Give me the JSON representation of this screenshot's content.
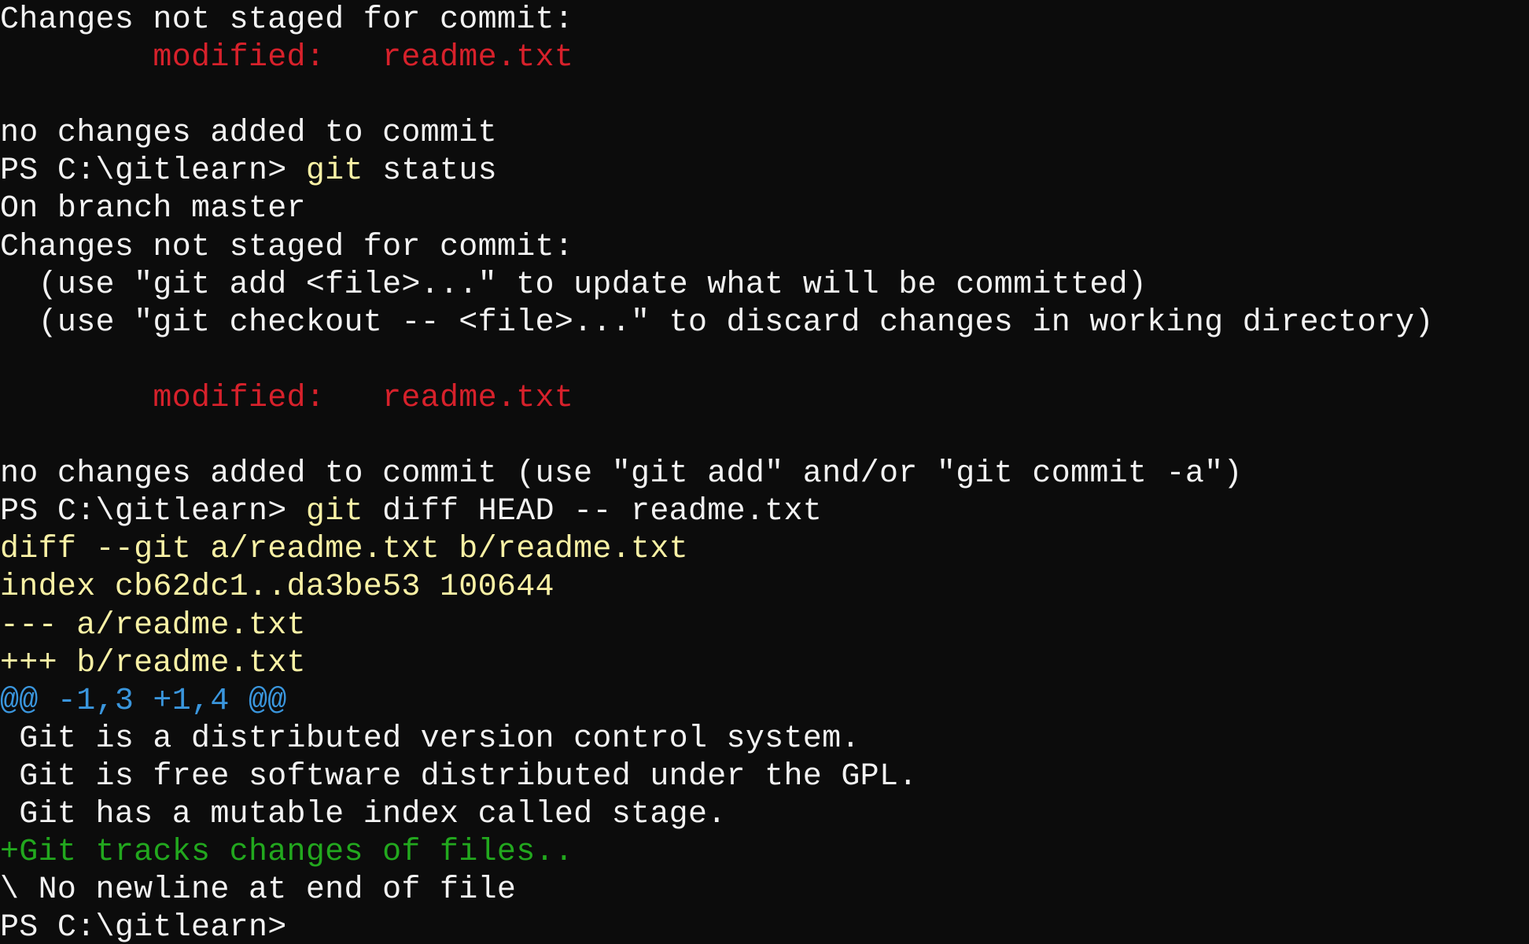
{
  "window": {
    "app": "PowerShell"
  },
  "colors": {
    "background": "#0c0c0c",
    "default": "#f2f2f2",
    "red": "#d7212b",
    "yellow": "#f9f1a5",
    "cyan": "#3a96dd",
    "green": "#22a81e"
  },
  "terminal": {
    "lines": [
      {
        "segments": [
          {
            "text": "Changes not staged for commit:",
            "color": "default"
          }
        ]
      },
      {
        "segments": [
          {
            "text": "        modified:   readme.txt",
            "color": "red"
          }
        ]
      },
      {
        "segments": [
          {
            "text": "",
            "color": "default"
          }
        ]
      },
      {
        "segments": [
          {
            "text": "no changes added to commit",
            "color": "default"
          }
        ]
      },
      {
        "segments": [
          {
            "text": "PS C:\\gitlearn> ",
            "color": "default"
          },
          {
            "text": "git",
            "color": "yellow"
          },
          {
            "text": " status",
            "color": "default"
          }
        ]
      },
      {
        "segments": [
          {
            "text": "On branch master",
            "color": "default"
          }
        ]
      },
      {
        "segments": [
          {
            "text": "Changes not staged for commit:",
            "color": "default"
          }
        ]
      },
      {
        "segments": [
          {
            "text": "  (use \"git add <file>...\" to update what will be committed)",
            "color": "default"
          }
        ]
      },
      {
        "segments": [
          {
            "text": "  (use \"git checkout -- <file>...\" to discard changes in working directory)",
            "color": "default"
          }
        ]
      },
      {
        "segments": [
          {
            "text": "",
            "color": "default"
          }
        ]
      },
      {
        "segments": [
          {
            "text": "        modified:   readme.txt",
            "color": "red"
          }
        ]
      },
      {
        "segments": [
          {
            "text": "",
            "color": "default"
          }
        ]
      },
      {
        "segments": [
          {
            "text": "no changes added to commit (use \"git add\" and/or \"git commit -a\")",
            "color": "default"
          }
        ]
      },
      {
        "segments": [
          {
            "text": "PS C:\\gitlearn> ",
            "color": "default"
          },
          {
            "text": "git",
            "color": "yellow"
          },
          {
            "text": " diff HEAD -- readme.txt",
            "color": "default"
          }
        ]
      },
      {
        "segments": [
          {
            "text": "diff --git a/readme.txt b/readme.txt",
            "color": "yellow"
          }
        ]
      },
      {
        "segments": [
          {
            "text": "index cb62dc1..da3be53 100644",
            "color": "yellow"
          }
        ]
      },
      {
        "segments": [
          {
            "text": "--- a/readme.txt",
            "color": "yellow"
          }
        ]
      },
      {
        "segments": [
          {
            "text": "+++ b/readme.txt",
            "color": "yellow"
          }
        ]
      },
      {
        "segments": [
          {
            "text": "@@ -1,3 +1,4 @@",
            "color": "cyan"
          }
        ]
      },
      {
        "segments": [
          {
            "text": " Git is a distributed version control system.",
            "color": "default"
          }
        ]
      },
      {
        "segments": [
          {
            "text": " Git is free software distributed under the GPL.",
            "color": "default"
          }
        ]
      },
      {
        "segments": [
          {
            "text": " Git has a mutable index called stage.",
            "color": "default"
          }
        ]
      },
      {
        "segments": [
          {
            "text": "+Git tracks changes of files..",
            "color": "green"
          }
        ]
      },
      {
        "segments": [
          {
            "text": "\\ No newline at end of file",
            "color": "default"
          }
        ]
      },
      {
        "segments": [
          {
            "text": "PS C:\\gitlearn>",
            "color": "default"
          }
        ]
      }
    ]
  }
}
